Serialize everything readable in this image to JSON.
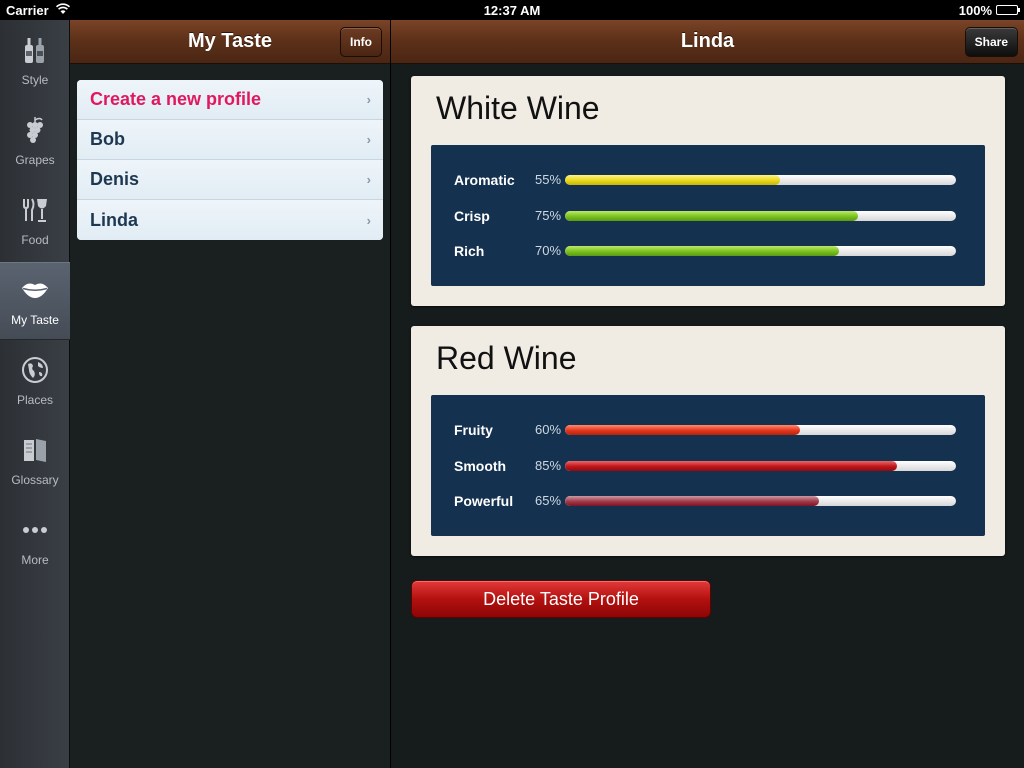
{
  "status": {
    "carrier": "Carrier",
    "time": "12:37 AM",
    "battery": "100%"
  },
  "tabs": [
    {
      "label": "Style",
      "icon": "bottles-icon",
      "active": false
    },
    {
      "label": "Grapes",
      "icon": "grapes-icon",
      "active": false
    },
    {
      "label": "Food",
      "icon": "fork-knife-glass-icon",
      "active": false
    },
    {
      "label": "My Taste",
      "icon": "lips-icon",
      "active": true
    },
    {
      "label": "Places",
      "icon": "globe-icon",
      "active": false
    },
    {
      "label": "Glossary",
      "icon": "book-icon",
      "active": false
    },
    {
      "label": "More",
      "icon": "more-dots-icon",
      "active": false
    }
  ],
  "master": {
    "title": "My Taste",
    "info_label": "Info",
    "items": [
      {
        "label": "Create a new profile"
      },
      {
        "label": "Bob"
      },
      {
        "label": "Denis"
      },
      {
        "label": "Linda"
      }
    ]
  },
  "detail": {
    "title": "Linda",
    "share_label": "Share",
    "sections": [
      {
        "title": "White Wine",
        "attributes": [
          {
            "label": "Aromatic",
            "value": 55,
            "display": "55%",
            "color": "#e9d81a"
          },
          {
            "label": "Crisp",
            "value": 75,
            "display": "75%",
            "color": "#7ac21f"
          },
          {
            "label": "Rich",
            "value": 70,
            "display": "70%",
            "color": "#7ac21f"
          }
        ]
      },
      {
        "title": "Red Wine",
        "attributes": [
          {
            "label": "Fruity",
            "value": 60,
            "display": "60%",
            "color": "#e3371c"
          },
          {
            "label": "Smooth",
            "value": 85,
            "display": "85%",
            "color": "#c1151a"
          },
          {
            "label": "Powerful",
            "value": 65,
            "display": "65%",
            "color": "#a2394a"
          }
        ]
      }
    ],
    "delete_label": "Delete Taste Profile"
  }
}
